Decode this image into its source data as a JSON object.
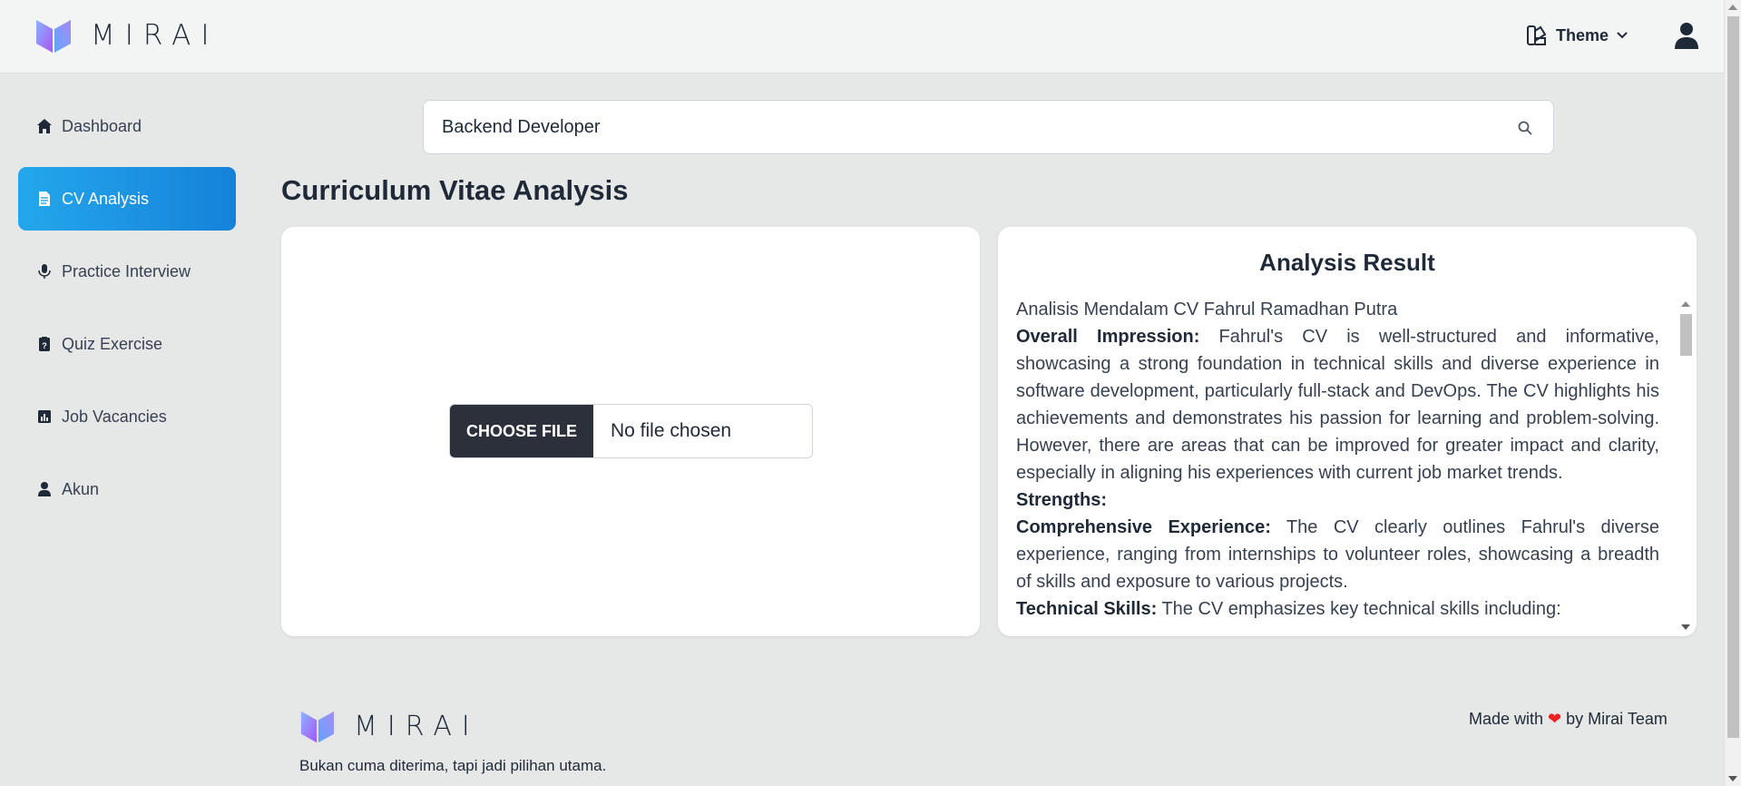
{
  "header": {
    "logo_text": "MIRAI",
    "theme_label": "Theme"
  },
  "sidebar": {
    "items": [
      {
        "label": "Dashboard",
        "icon": "home-icon",
        "active": false
      },
      {
        "label": "CV Analysis",
        "icon": "document-icon",
        "active": true
      },
      {
        "label": "Practice Interview",
        "icon": "microphone-icon",
        "active": false
      },
      {
        "label": "Quiz Exercise",
        "icon": "clipboard-question-icon",
        "active": false
      },
      {
        "label": "Job Vacancies",
        "icon": "bar-chart-icon",
        "active": false
      },
      {
        "label": "Akun",
        "icon": "user-icon",
        "active": false
      }
    ]
  },
  "search": {
    "value": "Backend Developer"
  },
  "page_title": "Curriculum Vitae Analysis",
  "upload": {
    "button_label": "CHOOSE FILE",
    "status": "No file chosen"
  },
  "result": {
    "title": "Analysis Result",
    "heading": "Analisis Mendalam CV Fahrul Ramadhan Putra",
    "overall_label": "Overall Impression:",
    "overall_text": " Fahrul's CV is well-structured and informative, showcasing a strong foundation in technical skills and diverse experience in software development, particularly full-stack and DevOps. The CV highlights his achievements and demonstrates his passion for learning and problem-solving. However, there are areas that can be improved for greater impact and clarity, especially in aligning his experiences with current job market trends.",
    "strengths_label": "Strengths:",
    "experience_label": "Comprehensive Experience:",
    "experience_text": " The CV clearly outlines Fahrul's diverse experience, ranging from internships to volunteer roles, showcasing a breadth of skills and exposure to various projects.",
    "technical_label": "Technical Skills:",
    "technical_text": " The CV emphasizes key technical skills including:"
  },
  "footer": {
    "logo_text": "MIRAI",
    "tagline": "Bukan cuma diterima, tapi jadi pilihan utama.",
    "made_with_prefix": "Made with",
    "made_with_suffix": "by Mirai Team"
  },
  "colors": {
    "accent": "#1e93e3",
    "heart": "#ef1f1f",
    "logo_gradient_start": "#7ea8ff",
    "logo_gradient_end": "#b06cf5"
  }
}
